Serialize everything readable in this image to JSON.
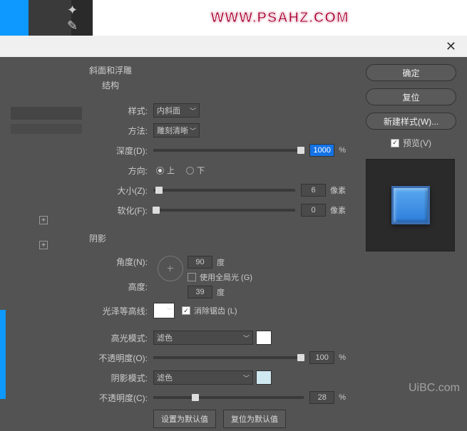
{
  "bg": {
    "url": "WWW.PSAHZ.COM"
  },
  "dialog": {
    "section_title": "斜面和浮雕",
    "structure_title": "结构",
    "style_label": "样式:",
    "style_value": "内斜面",
    "technique_label": "方法:",
    "technique_value": "雕刻清晰",
    "depth_label": "深度(D):",
    "depth_value": "1000",
    "depth_unit": "%",
    "direction_label": "方向:",
    "dir_up": "上",
    "dir_down": "下",
    "size_label": "大小(Z):",
    "size_value": "6",
    "size_unit": "像素",
    "soften_label": "软化(F):",
    "soften_value": "0",
    "soften_unit": "像素",
    "shading_title": "阴影",
    "angle_label": "角度(N):",
    "angle_value": "90",
    "angle_unit": "度",
    "global_light_label": "使用全局光 (G)",
    "altitude_label": "高度:",
    "altitude_value": "39",
    "altitude_unit": "度",
    "gloss_label": "光泽等高线:",
    "antialias_label": "消除锯齿 (L)",
    "highlight_mode_label": "高光模式:",
    "highlight_mode_value": "滤色",
    "highlight_opacity_label": "不透明度(O):",
    "highlight_opacity_value": "100",
    "highlight_opacity_unit": "%",
    "shadow_mode_label": "阴影模式:",
    "shadow_mode_value": "滤色",
    "shadow_opacity_label": "不透明度(C):",
    "shadow_opacity_value": "28",
    "shadow_opacity_unit": "%",
    "make_default": "设置为默认值",
    "reset_default": "复位为默认值"
  },
  "buttons": {
    "ok": "确定",
    "cancel": "复位",
    "new_style": "新建样式(W)...",
    "preview": "预览(V)"
  },
  "watermark": "UiBC.com"
}
